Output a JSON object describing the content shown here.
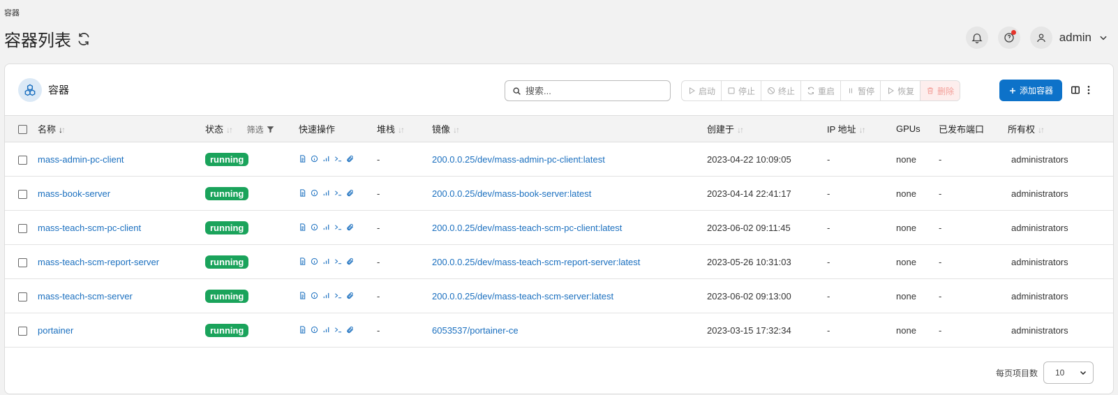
{
  "breadcrumb": "容器",
  "page_title": "容器列表",
  "user": {
    "name": "admin"
  },
  "card": {
    "title": "容器"
  },
  "search": {
    "placeholder": "搜索..."
  },
  "actions": {
    "start": "启动",
    "stop": "停止",
    "kill": "终止",
    "restart": "重启",
    "pause": "暂停",
    "resume": "恢复",
    "remove": "删除",
    "add": "添加容器"
  },
  "columns": {
    "name": "名称",
    "state": "状态",
    "filter": "筛选",
    "quick_actions": "快速操作",
    "stack": "堆栈",
    "image": "镜像",
    "created": "创建于",
    "ip": "IP 地址",
    "gpus": "GPUs",
    "ports": "已发布端口",
    "ownership": "所有权"
  },
  "rows": [
    {
      "name": "mass-admin-pc-client",
      "state": "running",
      "stack": "-",
      "image": "200.0.0.25/dev/mass-admin-pc-client:latest",
      "created": "2023-04-22 10:09:05",
      "ip": "-",
      "gpus": "none",
      "ports": "-",
      "ownership": "administrators"
    },
    {
      "name": "mass-book-server",
      "state": "running",
      "stack": "-",
      "image": "200.0.0.25/dev/mass-book-server:latest",
      "created": "2023-04-14 22:41:17",
      "ip": "-",
      "gpus": "none",
      "ports": "-",
      "ownership": "administrators"
    },
    {
      "name": "mass-teach-scm-pc-client",
      "state": "running",
      "stack": "-",
      "image": "200.0.0.25/dev/mass-teach-scm-pc-client:latest",
      "created": "2023-06-02 09:11:45",
      "ip": "-",
      "gpus": "none",
      "ports": "-",
      "ownership": "administrators"
    },
    {
      "name": "mass-teach-scm-report-server",
      "state": "running",
      "stack": "-",
      "image": "200.0.0.25/dev/mass-teach-scm-report-server:latest",
      "created": "2023-05-26 10:31:03",
      "ip": "-",
      "gpus": "none",
      "ports": "-",
      "ownership": "administrators"
    },
    {
      "name": "mass-teach-scm-server",
      "state": "running",
      "stack": "-",
      "image": "200.0.0.25/dev/mass-teach-scm-server:latest",
      "created": "2023-06-02 09:13:00",
      "ip": "-",
      "gpus": "none",
      "ports": "-",
      "ownership": "administrators"
    },
    {
      "name": "portainer",
      "state": "running",
      "stack": "-",
      "image": "6053537/portainer-ce",
      "created": "2023-03-15 17:32:34",
      "ip": "-",
      "gpus": "none",
      "ports": "-",
      "ownership": "administrators"
    }
  ],
  "pagination": {
    "label": "每页项目数",
    "page_size": "10"
  },
  "colors": {
    "accent": "#0d72c9",
    "running": "#1aa35b",
    "link": "#1a6fbf",
    "danger": "#e5332a"
  },
  "icons": [
    "refresh-icon",
    "bell-icon",
    "help-icon",
    "user-icon",
    "chevron-down-icon",
    "containers-icon",
    "search-icon",
    "play-icon",
    "stop-icon",
    "kill-icon",
    "restart-icon",
    "pause-icon",
    "resume-icon",
    "trash-icon",
    "plus-icon",
    "columns-icon",
    "kebab-icon",
    "filter-icon",
    "logs-icon",
    "inspect-icon",
    "stats-icon",
    "console-icon",
    "attach-icon"
  ]
}
